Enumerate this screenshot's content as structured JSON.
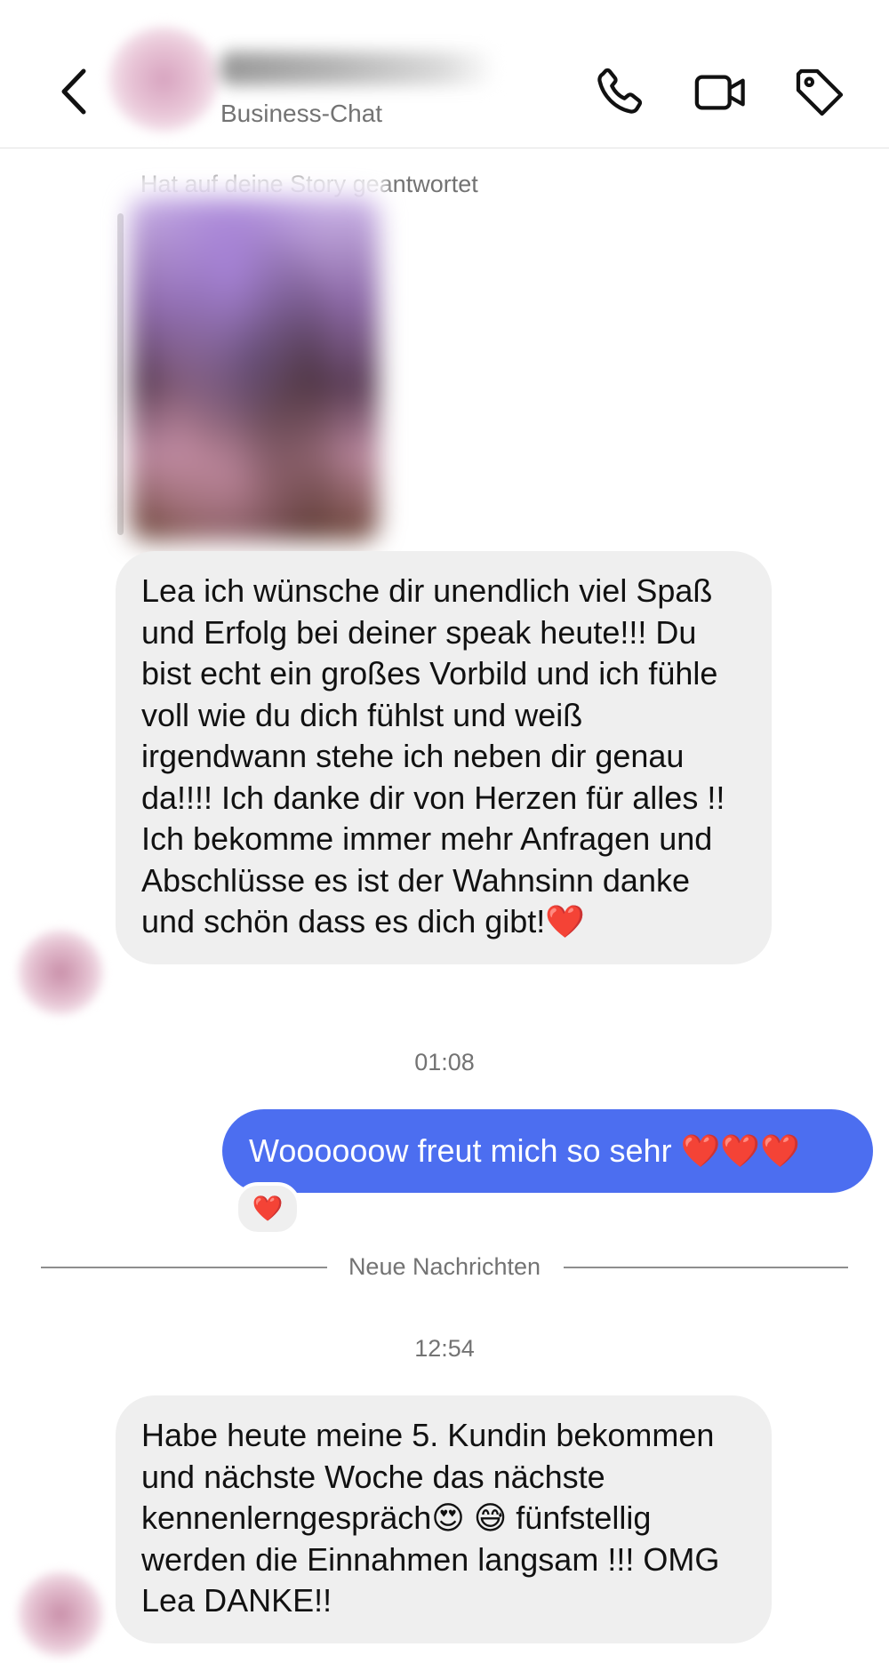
{
  "header": {
    "subtitle": "Business-Chat",
    "icons": [
      "chevron-left-icon",
      "phone-icon",
      "video-camera-icon",
      "tag-icon"
    ]
  },
  "story": {
    "label": "Hat auf deine Story geantwortet"
  },
  "messages": {
    "incoming_1": "Lea ich wünsche dir unendlich viel Spaß und Erfolg bei deiner speak heute!!! Du bist echt ein großes Vorbild und ich fühle voll wie du dich fühlst und weiß irgendwann stehe ich neben dir genau da!!!! Ich danke dir von Herzen für alles !! Ich bekomme immer mehr Anfragen und Abschlüsse es ist der Wahnsinn danke und schön dass es dich gibt!❤️",
    "time_1": "01:08",
    "outgoing_1": "Woooooow freut mich so sehr ❤️❤️❤️",
    "reaction_1": "❤️",
    "divider": "Neue Nachrichten",
    "time_2": "12:54",
    "incoming_2": "Habe heute meine 5. Kundin bekommen und nächste Woche das nächste kennenlerngespräch😍 😅 fünfstellig werden die Einnahmen langsam !!! OMG Lea DANKE!!"
  },
  "colors": {
    "outgoing_bubble": "#4c6ef0",
    "incoming_bubble": "#efefef",
    "muted_text": "#737373"
  }
}
